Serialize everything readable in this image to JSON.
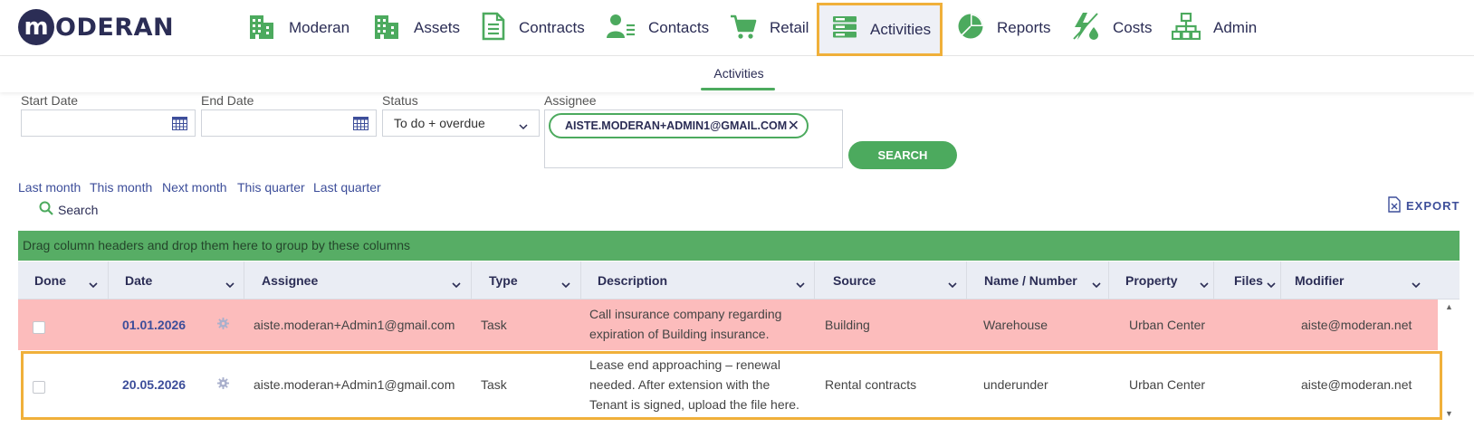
{
  "brand": {
    "logo_letter": "m",
    "logo_text": "ODERAN"
  },
  "nav": [
    {
      "label": "Moderan",
      "icon": "building-icon"
    },
    {
      "label": "Assets",
      "icon": "building-icon"
    },
    {
      "label": "Contracts",
      "icon": "document-icon"
    },
    {
      "label": "Contacts",
      "icon": "contacts-icon"
    },
    {
      "label": "Retail",
      "icon": "cart-icon"
    },
    {
      "label": "Activities",
      "icon": "server-list-icon",
      "active": true
    },
    {
      "label": "Reports",
      "icon": "pie-chart-icon"
    },
    {
      "label": "Costs",
      "icon": "energy-icon"
    },
    {
      "label": "Admin",
      "icon": "org-chart-icon"
    }
  ],
  "subnav": {
    "tab": "Activities"
  },
  "filters": {
    "start_date_label": "Start Date",
    "start_date_value": "",
    "end_date_label": "End Date",
    "end_date_value": "",
    "status_label": "Status",
    "status_value": "To do + overdue",
    "assignee_label": "Assignee",
    "assignee_chip": "AISTE.MODERAN+ADMIN1@GMAIL.COM",
    "search_button": "SEARCH"
  },
  "quick_ranges": [
    "Last month",
    "This month",
    "Next month",
    "This quarter",
    "Last quarter"
  ],
  "search_link": "Search",
  "export_label": "EXPORT",
  "group_bar": "Drag column headers and drop them here to group by these columns",
  "columns": [
    "Done",
    "Date",
    "Assignee",
    "Type",
    "Description",
    "Source",
    "Name / Number",
    "Property",
    "Files",
    "Modifier"
  ],
  "rows": [
    {
      "done": false,
      "date": "01.01.2026",
      "assignee": "aiste.moderan+Admin1@gmail.com",
      "type": "Task",
      "description": [
        "Call insurance company regarding",
        "expiration of Building insurance."
      ],
      "source": "Building",
      "name_number": "Warehouse",
      "property": "Urban Center",
      "modifier": "aiste@moderan.net",
      "status": "overdue"
    },
    {
      "done": false,
      "date": "20.05.2026",
      "assignee": "aiste.moderan+Admin1@gmail.com",
      "type": "Task",
      "description": [
        "Lease end approaching – renewal",
        "needed. After extension with the",
        "Tenant is signed, upload the file here."
      ],
      "source": "Rental contracts",
      "name_number": "underunder",
      "property": "Urban Center",
      "modifier": "aiste@moderan.net",
      "status": "todo"
    }
  ],
  "colors": {
    "brand_navy": "#2b2d55",
    "accent_green": "#4caa5e",
    "highlight_orange": "#f0b03a",
    "overdue_row": "#fcbcbc",
    "link_blue": "#3d4e9a"
  }
}
